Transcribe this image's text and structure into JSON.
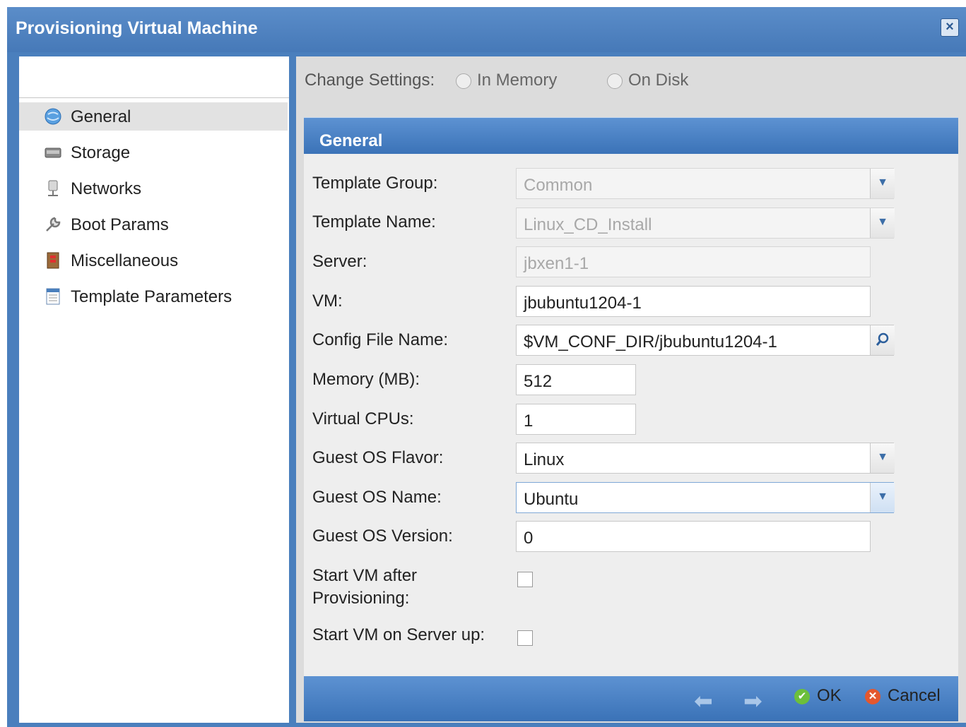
{
  "window": {
    "title": "Provisioning Virtual Machine",
    "close_icon": "close-icon"
  },
  "sidebar": {
    "items": [
      {
        "label": "General",
        "icon": "globe-icon",
        "active": true
      },
      {
        "label": "Storage",
        "icon": "disk-icon",
        "active": false
      },
      {
        "label": "Networks",
        "icon": "network-icon",
        "active": false
      },
      {
        "label": "Boot Params",
        "icon": "wrench-icon",
        "active": false
      },
      {
        "label": "Miscellaneous",
        "icon": "misc-icon",
        "active": false
      },
      {
        "label": "Template Parameters",
        "icon": "template-icon",
        "active": false
      }
    ]
  },
  "settings": {
    "label": "Change Settings:",
    "options": [
      "In Memory",
      "On Disk"
    ]
  },
  "panel": {
    "title": "General"
  },
  "form": {
    "template_group": {
      "label": "Template Group:",
      "value": "Common"
    },
    "template_name": {
      "label": "Template Name:",
      "value": "Linux_CD_Install"
    },
    "server": {
      "label": "Server:",
      "value": "jbxen1-1"
    },
    "vm": {
      "label": "VM:",
      "value": "jbubuntu1204-1"
    },
    "config_file": {
      "label": "Config File Name:",
      "value": "$VM_CONF_DIR/jbubuntu1204-1"
    },
    "memory": {
      "label": "Memory (MB):",
      "value": "512"
    },
    "vcpus": {
      "label": "Virtual CPUs:",
      "value": "1"
    },
    "os_flavor": {
      "label": "Guest OS Flavor:",
      "value": "Linux"
    },
    "os_name": {
      "label": "Guest OS Name:",
      "value": "Ubuntu"
    },
    "os_version": {
      "label": "Guest OS Version:",
      "value": "0"
    },
    "start_after": {
      "label_line1": "Start VM after",
      "label_line2": "Provisioning:",
      "checked": false
    },
    "start_on_server_up": {
      "label": "Start VM on Server up:",
      "checked": false
    }
  },
  "footer": {
    "ok_label": "OK",
    "cancel_label": "Cancel"
  },
  "colors": {
    "title_bar": "#4a7fbd",
    "panel_header": "#3a72b7",
    "ok": "#6cbf3b",
    "cancel": "#e4572e"
  }
}
